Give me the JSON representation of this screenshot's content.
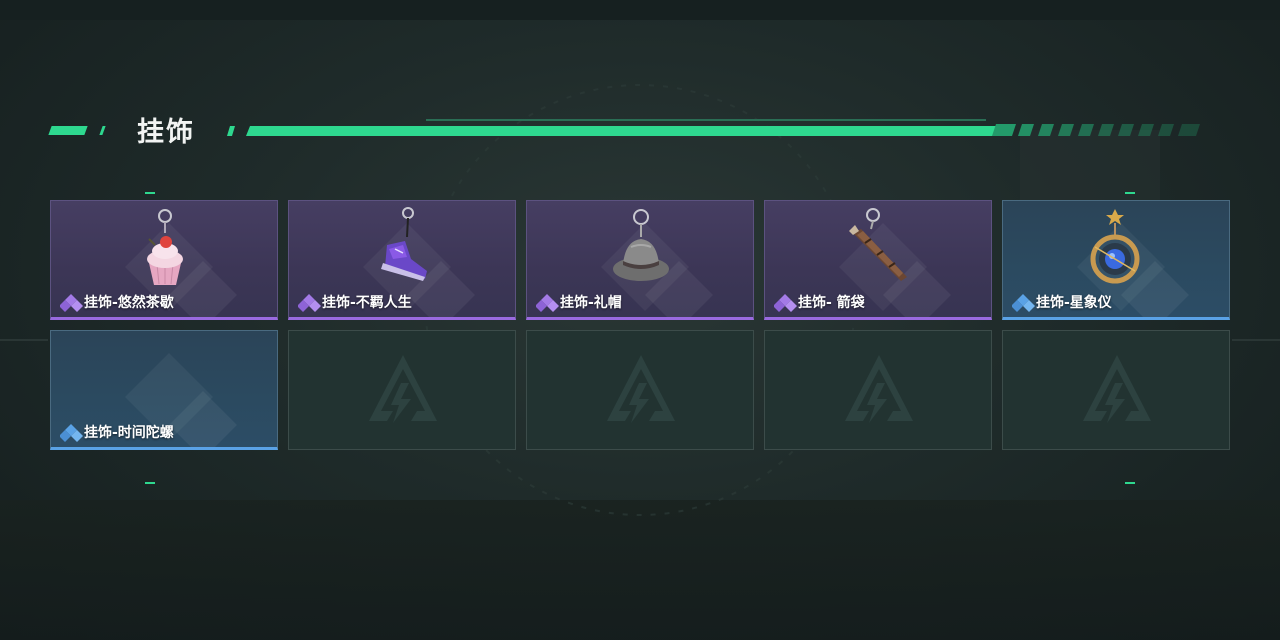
{
  "section": {
    "title": "挂饰"
  },
  "colors": {
    "accent": "#2ed88f",
    "rarity_purple": "#9a6ae0",
    "rarity_blue": "#5aa2e6"
  },
  "items": [
    {
      "name": "挂饰-悠然茶歇",
      "rarity": "purple",
      "icon": "cupcake-charm-icon"
    },
    {
      "name": "挂饰-不羁人生",
      "rarity": "purple",
      "icon": "sneaker-charm-icon"
    },
    {
      "name": "挂饰-礼帽",
      "rarity": "purple",
      "icon": "fedora-hat-charm-icon"
    },
    {
      "name": "挂饰- 箭袋",
      "rarity": "purple",
      "icon": "arrow-quiver-charm-icon"
    },
    {
      "name": "挂饰-星象仪",
      "rarity": "blue",
      "icon": "astrolabe-charm-icon"
    },
    {
      "name": "挂饰-时间陀螺",
      "rarity": "blue",
      "icon": "diamond-pattern-icon"
    }
  ],
  "empty_slots": 4
}
